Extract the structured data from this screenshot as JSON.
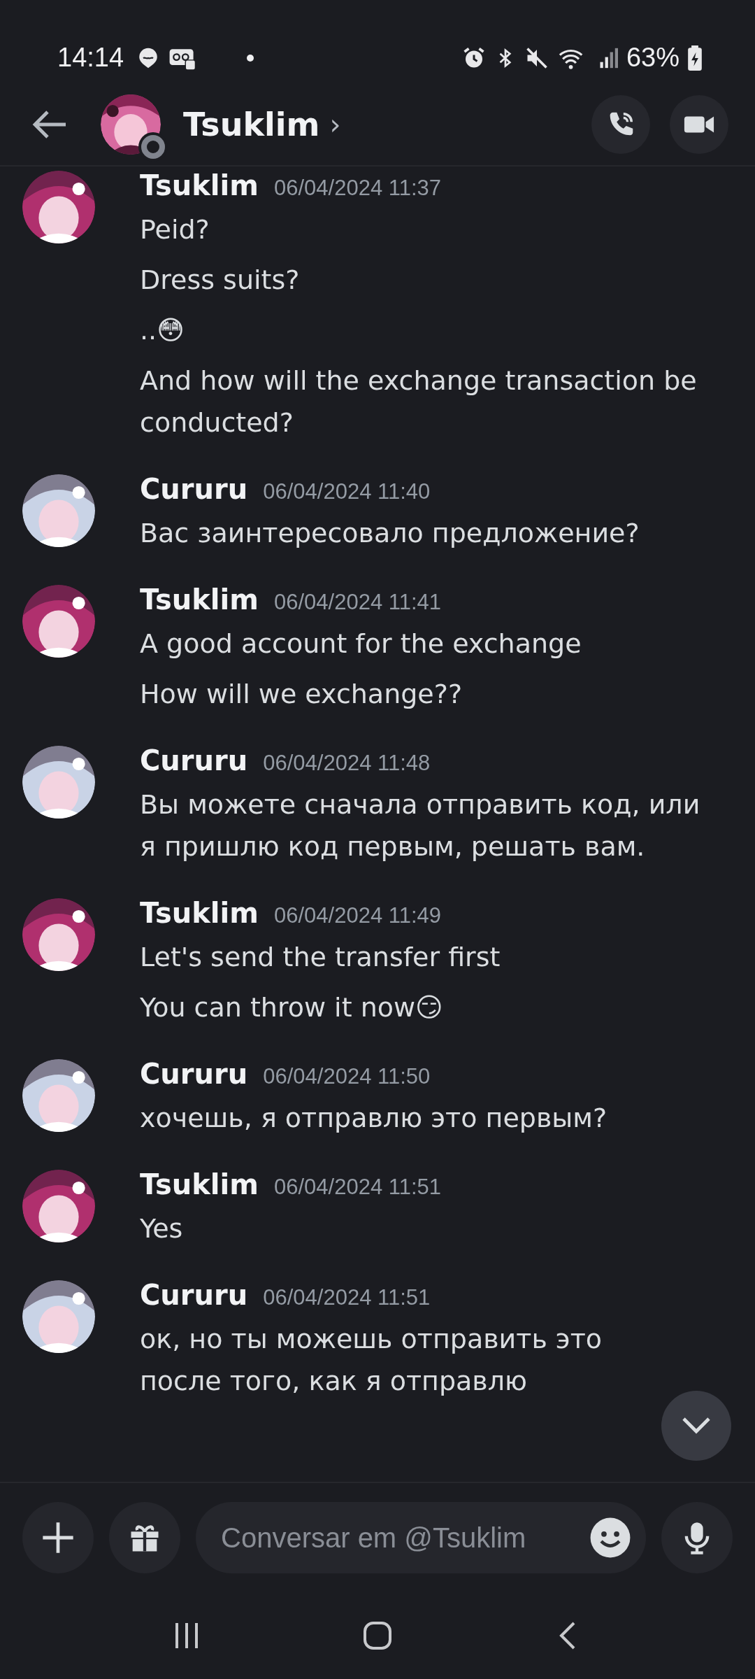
{
  "status_bar": {
    "time": "14:14",
    "battery": "63%"
  },
  "header": {
    "name": "Tsuklim",
    "chevron": "›",
    "avatar": {
      "kind": "picture"
    }
  },
  "messages": [
    {
      "author": "Tsuklim",
      "time": "06/04/2024 11:37",
      "avatar": {
        "kind": "picture",
        "color": "#b0306e"
      },
      "lines": [
        "Peid?",
        "Dress suits?",
        "..😳",
        "And how will the exchange transaction be conducted?"
      ]
    },
    {
      "author": "Cururu",
      "time": "06/04/2024 11:40",
      "avatar": {
        "kind": "picture",
        "color": "#c9d3e6"
      },
      "lines": [
        "Вас заинтересовало предложение?"
      ]
    },
    {
      "author": "Tsuklim",
      "time": "06/04/2024 11:41",
      "avatar": {
        "kind": "picture",
        "color": "#b0306e"
      },
      "lines": [
        "A good account for the exchange",
        "How will we exchange??"
      ]
    },
    {
      "author": "Cururu",
      "time": "06/04/2024 11:48",
      "avatar": {
        "kind": "picture",
        "color": "#c9d3e6"
      },
      "lines": [
        "Вы можете сначала отправить код, или я пришлю код первым, решать вам."
      ]
    },
    {
      "author": "Tsuklim",
      "time": "06/04/2024 11:49",
      "avatar": {
        "kind": "picture",
        "color": "#b0306e"
      },
      "lines": [
        "Let's send the transfer first",
        "You can throw it now😏"
      ]
    },
    {
      "author": "Cururu",
      "time": "06/04/2024 11:50",
      "avatar": {
        "kind": "picture",
        "color": "#c9d3e6"
      },
      "lines": [
        "хочешь, я отправлю это первым?"
      ]
    },
    {
      "author": "Tsuklim",
      "time": "06/04/2024 11:51",
      "avatar": {
        "kind": "picture",
        "color": "#b0306e"
      },
      "lines": [
        "Yes"
      ]
    },
    {
      "author": "Cururu",
      "time": "06/04/2024 11:51",
      "avatar": {
        "kind": "picture",
        "color": "#c9d3e6"
      },
      "lines": [
        "ок, но ты можешь отправить это после того, как я отправлю"
      ]
    }
  ],
  "composer": {
    "placeholder": "Conversar em @Tsuklim"
  }
}
